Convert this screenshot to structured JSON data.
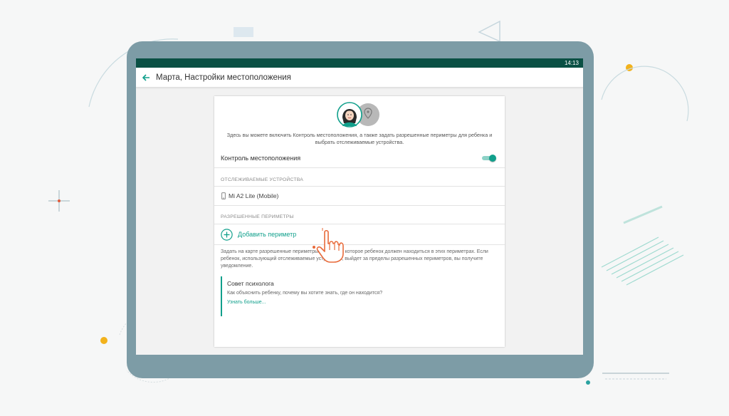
{
  "status_bar": {
    "time": "14:13"
  },
  "app_bar": {
    "title": "Марта, Настройки местоположения",
    "back_icon": "arrow-left-icon"
  },
  "card": {
    "intro": "Здесь вы можете включить Контроль местоположения, а также задать разрешенные периметры для ребенка и выбрать отслеживаемые устройства.",
    "location_control": {
      "label": "Контроль местоположения",
      "enabled": true
    },
    "tracked_devices": {
      "header": "ОТСЛЕЖИВАЕМЫЕ УСТРОЙСТВА",
      "items": [
        {
          "label": "Mi A2 Lite (Mobile)",
          "icon": "phone-icon"
        }
      ]
    },
    "perimeters": {
      "header": "РАЗРЕШЕННЫЕ ПЕРИМЕТРЫ",
      "add_label": "Добавить периметр",
      "add_icon": "plus-circle-icon",
      "description": "Задать на карте разрешенные периметры и время, в которое ребенок должен находиться в этих периметрах. Если ребенок, использующий отслеживаемые устройства, выйдет за пределы разрешенных периметров, вы получите уведомление."
    },
    "tip": {
      "title": "Совет психолога",
      "subtitle": "Как объяснить ребенку, почему вы хотите знать, где он находится?",
      "link": "Узнать больше..."
    }
  },
  "colors": {
    "accent": "#11a08c",
    "status_bar": "#0a5044",
    "tablet_frame": "#7d9ca6"
  }
}
